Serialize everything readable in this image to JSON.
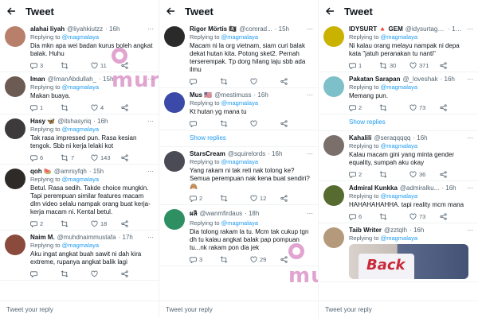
{
  "header": {
    "title": "Tweet"
  },
  "reply_placeholder": "Tweet your reply",
  "watermark": "murai",
  "show_replies": "Show replies",
  "columns": [
    {
      "tweets": [
        {
          "name": "alahai liyah",
          "handle": "@liyahkiutzz",
          "time": "· 16h",
          "reply_to": "@magmalaya",
          "text": "Dia mkn apa wei badan kurus boleh angkat balak. Huhu",
          "stats": [
            "3",
            "",
            "11",
            ""
          ],
          "avatar": "#b87f6a"
        },
        {
          "name": "Iman",
          "handle": "@ImanAbdullah_",
          "time": "· 15h",
          "reply_to": "@magmalaya",
          "text": "Makan buaya.",
          "stats": [
            "1",
            "",
            "4",
            ""
          ],
          "avatar": "#6b5b52"
        },
        {
          "name": "Hasy 🦋",
          "handle": "@itshasyriq",
          "time": "· 16h",
          "reply_to": "@magmalaya",
          "text": "Tak rasa impressed pun. Rasa kesian tengok. Sbb ni kerja lelaki kot",
          "stats": [
            "6",
            "7",
            "143",
            ""
          ],
          "avatar": "#3c3a3a"
        },
        {
          "name": "qoh 🍉",
          "handle": "@amrsyfqh",
          "time": "· 15h",
          "reply_to": "@magmalaya",
          "text": "Betul. Rasa sedih. Takde choice mungkin. Tapi perempuan similar features macam dlm video selalu nampak orang buat kerja-kerja macam ni. Kental betul.",
          "stats": [
            "2",
            "",
            "18",
            ""
          ],
          "avatar": "#2e2a28"
        },
        {
          "name": "Naim M.",
          "handle": "@muhdnaimmustafa",
          "time": "· 17h",
          "reply_to": "@magmalaya",
          "text": "Aku ingat angkat buah sawit ni dah kira extreme, rupanya angkat balik lagi",
          "stats": [
            "",
            "",
            "",
            ""
          ],
          "avatar": "#8a4b3d"
        }
      ]
    },
    {
      "tweets": [
        {
          "name": "Rigor Mörtis 🏴‍☠️",
          "handle": "@comrad...",
          "time": "· 15h",
          "reply_to": "@magmalaya",
          "text": "Macam ni la org vietnam, siam curi balak dekat hutan kita. Potong sket2. Pernah terserempak. Tp dorg hilang laju sbb ada ilmu",
          "stats": [
            "",
            "",
            "",
            ""
          ],
          "avatar": "#2a2a2a"
        },
        {
          "name": "Mus 🇺🇸",
          "handle": "@mestimuss",
          "time": "· 16h",
          "reply_to": "@magmalaya",
          "text": "Kt hutan yg mana tu",
          "stats": [
            "",
            "",
            "",
            ""
          ],
          "avatar": "#3b4aa8",
          "show_replies": true
        },
        {
          "name": "StarsCream",
          "handle": "@squirelords",
          "time": "· 16h",
          "reply_to": "@magmalaya",
          "text": "Yang rakam ni tak reti nak tolong ke? Semua perempuan nak kena buat sendiri? 🙈",
          "stats": [
            "2",
            "",
            "12",
            ""
          ],
          "avatar": "#4b4b55"
        },
        {
          "name": "",
          "handle": "@wanmfirdaus",
          "time": "· 18h",
          "reply_to": "@magmalaya",
          "text": "Dia tolong rakam la tu. Mcm tak cukup tgn dh tu kalau angkat balak pap pompuan tu...nk rakam pon dia jek",
          "stats": [
            "3",
            "",
            "29",
            ""
          ],
          "avatar": "#2e8f63",
          "name_mark": "ผลิ"
        }
      ]
    },
    {
      "tweets": [
        {
          "name": "IDYSURT 🔺 GEM",
          "handle": "@idysurtagem",
          "time": "· 16h",
          "reply_to": "@magmalaya",
          "text": "Ni kalau orang melayu nampak ni depa kata \"jatuh peranakan tu nanti\"",
          "stats": [
            "1",
            "30",
            "371",
            ""
          ],
          "avatar": "#c9b200"
        },
        {
          "name": "Pakatan Sarapan",
          "handle": "@_loveshak",
          "time": "· 16h",
          "reply_to": "@magmalaya",
          "text": "Memang pun.",
          "stats": [
            "2",
            "",
            "73",
            ""
          ],
          "avatar": "#7ec0c9",
          "show_replies": true
        },
        {
          "name": "Kahalili",
          "handle": "@seraqqqqq",
          "time": "· 16h",
          "reply_to": "@magmalaya",
          "text": "Kalau macam gini yang minta gender equality, sumpah aku okay",
          "stats": [
            "2",
            "",
            "36",
            ""
          ],
          "avatar": "#7a6f6a"
        },
        {
          "name": "Admiral Kunkka",
          "handle": "@admiralku...",
          "time": "· 16h",
          "reply_to": "@magmalaya",
          "text": "HAHAHAHAHHA. tapi reality mcm mana",
          "stats": [
            "6",
            "",
            "73",
            ""
          ],
          "avatar": "#556b2f"
        },
        {
          "name": "Taib Writer",
          "handle": "@zztqlh",
          "time": "· 16h",
          "reply_to": "@magmalaya",
          "text": "",
          "stats": [
            "",
            "",
            "",
            ""
          ],
          "avatar": "#b49a7a",
          "photo_text": "Back"
        }
      ]
    }
  ]
}
